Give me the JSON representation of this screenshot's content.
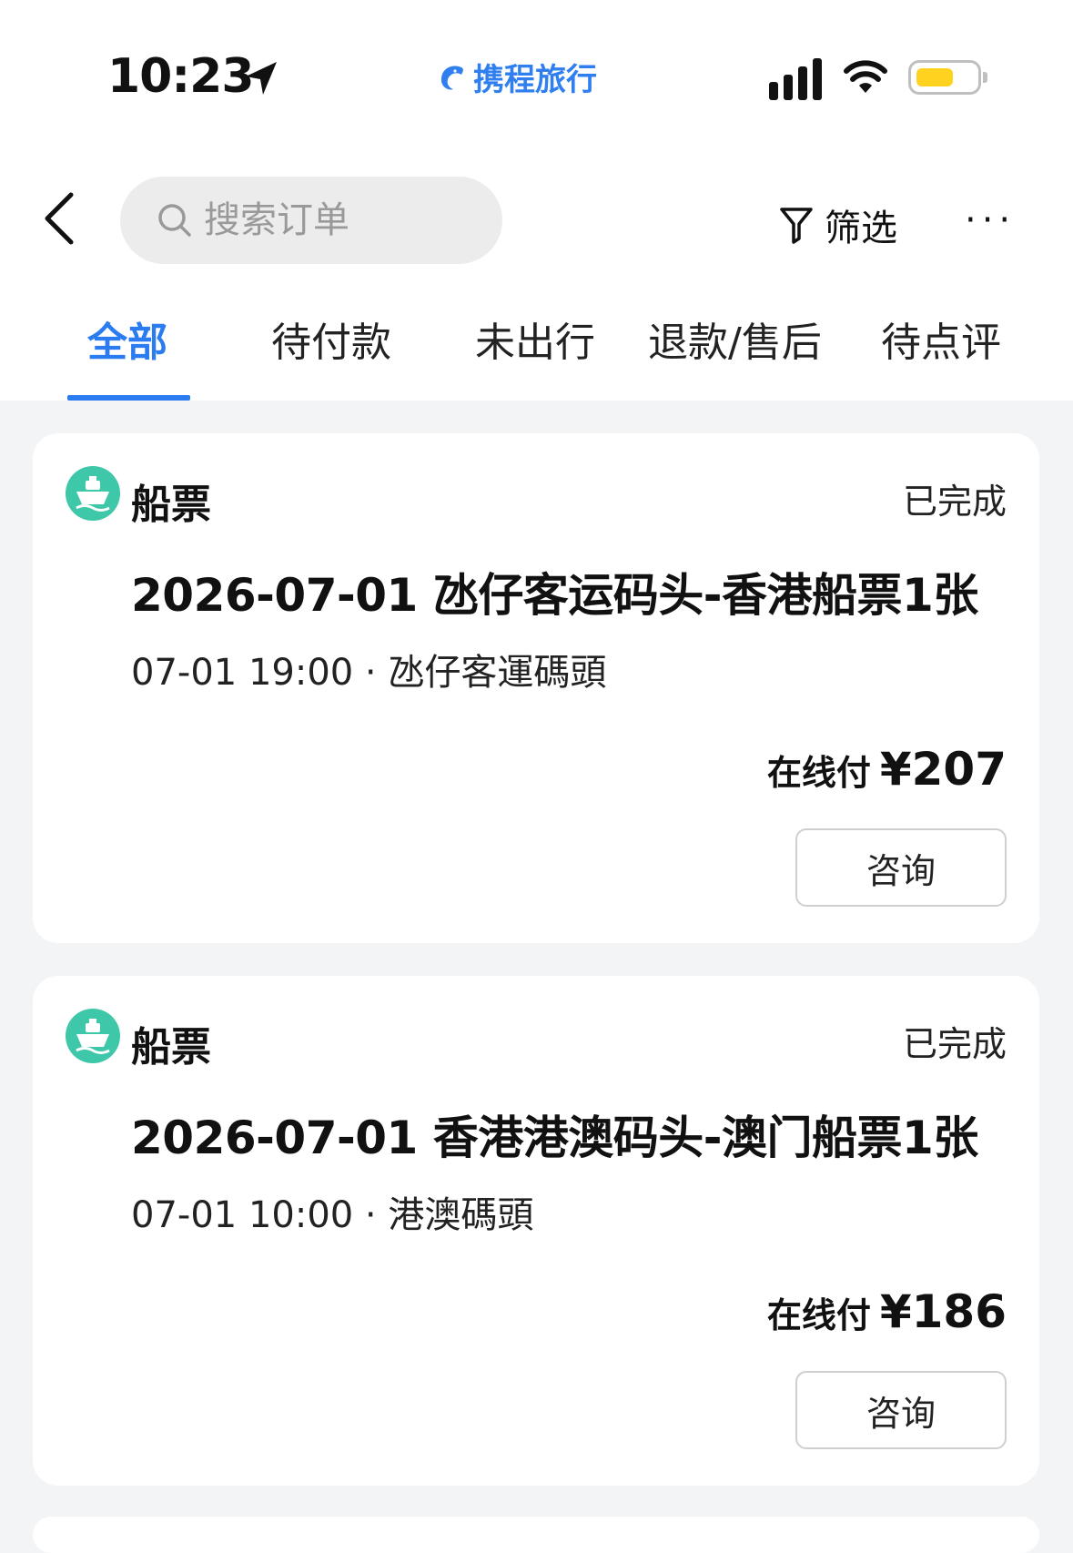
{
  "status_bar": {
    "time": "10:23",
    "app_brand": "携程旅行"
  },
  "header": {
    "search_placeholder": "搜索订单",
    "filter_label": "筛选",
    "more_label": "···"
  },
  "tabs": [
    {
      "label": "全部",
      "active": true
    },
    {
      "label": "待付款"
    },
    {
      "label": "未出行"
    },
    {
      "label": "退款/售后"
    },
    {
      "label": "待点评"
    }
  ],
  "orders": [
    {
      "category": "船票",
      "status": "已完成",
      "title": "2026-07-01 氹仔客运码头-香港船票1张",
      "subtitle": "07-01 19:00 · 氹仔客運碼頭",
      "pay_label": "在线付",
      "amount": "¥207",
      "button_label": "咨询"
    },
    {
      "category": "船票",
      "status": "已完成",
      "title": "2026-07-01 香港港澳码头-澳门船票1张",
      "subtitle": "07-01 10:00 · 港澳碼頭",
      "pay_label": "在线付",
      "amount": "¥186",
      "button_label": "咨询"
    }
  ],
  "colors": {
    "accent": "#2a7cf0",
    "ship_icon": "#3ec7a8",
    "battery": "#ffd21f"
  }
}
